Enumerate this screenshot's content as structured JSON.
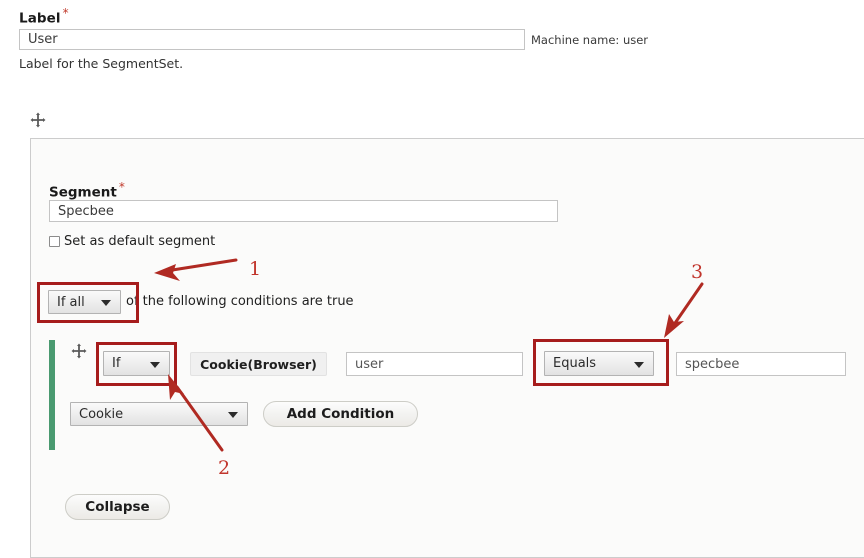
{
  "form": {
    "label_field": {
      "label": "Label",
      "required_marker": "*",
      "value": "User",
      "placeholder": "User",
      "machine_name": "Machine name: user",
      "description": "Label for the SegmentSet."
    }
  },
  "segment_panel": {
    "drag_handle_icon": "move-cross-icon",
    "segment_field": {
      "label": "Segment",
      "required_marker": "*",
      "value": "Specbee",
      "placeholder": "Specbee"
    },
    "default_segment_checkbox": {
      "label": "Set as default segment",
      "checked": false
    },
    "condition_logic": {
      "select_value": "If all",
      "trailing_text": "of the following conditions are true"
    },
    "condition_row": {
      "drag_handle_icon": "move-cross-icon",
      "if_select_value": "If",
      "plugin_label": "Cookie(Browser)",
      "cookie_name_value": "user",
      "cookie_name_placeholder": "user",
      "operator_select_value": "Equals",
      "operator_value": "specbee",
      "operator_value_placeholder": "specbee"
    },
    "add_condition_row": {
      "plugin_select_value": "Cookie",
      "add_button_label": "Add Condition"
    },
    "collapse_button_label": "Collapse"
  },
  "annotations": {
    "markers": [
      {
        "number": "1",
        "points_to": "if-all-select"
      },
      {
        "number": "2",
        "points_to": "if-select"
      },
      {
        "number": "3",
        "points_to": "equals-select"
      }
    ],
    "color": "#a61c1c",
    "number_color": "#c1352c"
  },
  "colors": {
    "accent_green": "#4a9a70",
    "panel_bg": "#fbfbfa",
    "annotation_red": "#a61c1c",
    "required_star": "#c0392b"
  }
}
